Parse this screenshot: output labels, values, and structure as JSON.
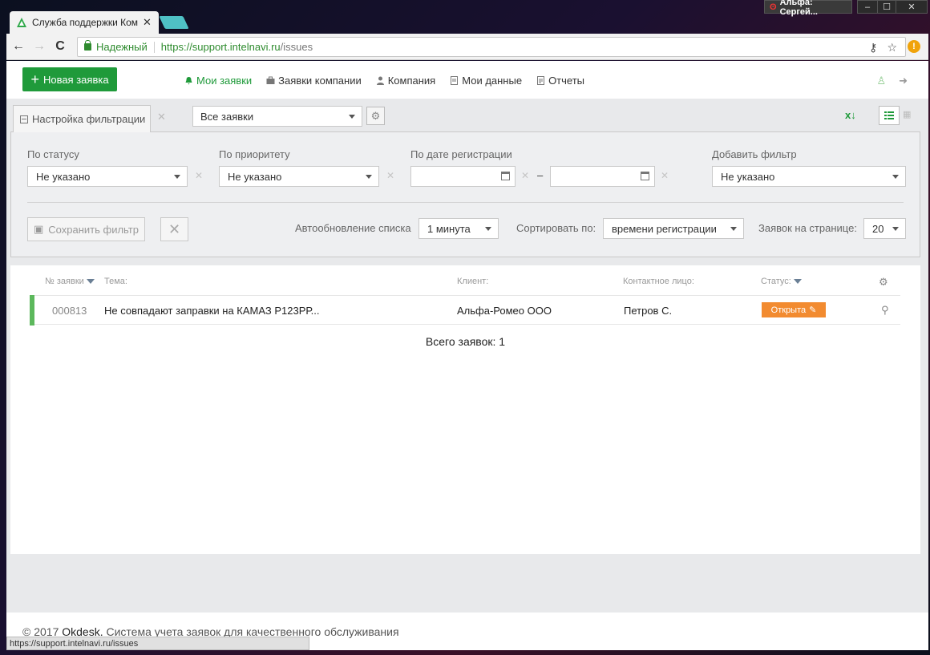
{
  "browser": {
    "tab_title": "Служба поддержки Ком",
    "tab_close": "✕",
    "user_label": "Альфа: Сергей...",
    "secure_label": "Надежный",
    "url_host": "https://support.intelnavi.ru",
    "url_path": "/issues",
    "status_url": "https://support.intelnavi.ru/issues",
    "window_controls": [
      "–",
      "☐",
      "✕"
    ]
  },
  "appbar": {
    "new_button": "Новая заявка",
    "nav": [
      {
        "label": "Мои заявки",
        "icon": "bell-icon",
        "active": true
      },
      {
        "label": "Заявки компании",
        "icon": "briefcase-icon",
        "active": false
      },
      {
        "label": "Компания",
        "icon": "user-icon",
        "active": false
      },
      {
        "label": "Мои данные",
        "icon": "document-icon",
        "active": false
      },
      {
        "label": "Отчеты",
        "icon": "report-icon",
        "active": false
      }
    ]
  },
  "filter": {
    "tab_label": "Настройка фильтрации",
    "preset_value": "Все заявки",
    "status_label": "По статусу",
    "status_value": "Не указано",
    "priority_label": "По приоритету",
    "priority_value": "Не указано",
    "date_label": "По дате регистрации",
    "date_from": "",
    "date_to": "",
    "date_dash": "–",
    "add_label": "Добавить фильтр",
    "add_value": "Не указано",
    "save_button": "Сохранить фильтр",
    "autorefresh_label": "Автообновление списка",
    "autorefresh_value": "1 минута",
    "sort_label": "Сортировать по:",
    "sort_value": "времени регистрации",
    "perpage_label": "Заявок на странице:",
    "perpage_value": "20"
  },
  "table": {
    "headers": {
      "number": "№ заявки",
      "subject": "Тема:",
      "client": "Клиент:",
      "contact": "Контактное лицо:",
      "status": "Статус:"
    },
    "rows": [
      {
        "number": "000813",
        "subject": "Не совпадают заправки на КАМАЗ Р123РР...",
        "client": "Альфа-Ромео ООО",
        "contact": "Петров С.",
        "status": "Открыта",
        "status_color": "#f28b30",
        "bar_color": "#5cb85c"
      }
    ],
    "total": "Всего заявок: 1"
  },
  "footer": {
    "prefix": "© 2017",
    "brand": "Okdesk.",
    "text": "Система учета заявок для качественного обслуживания"
  },
  "colors": {
    "accent": "#1f9a3a",
    "status_open": "#f28b30"
  }
}
